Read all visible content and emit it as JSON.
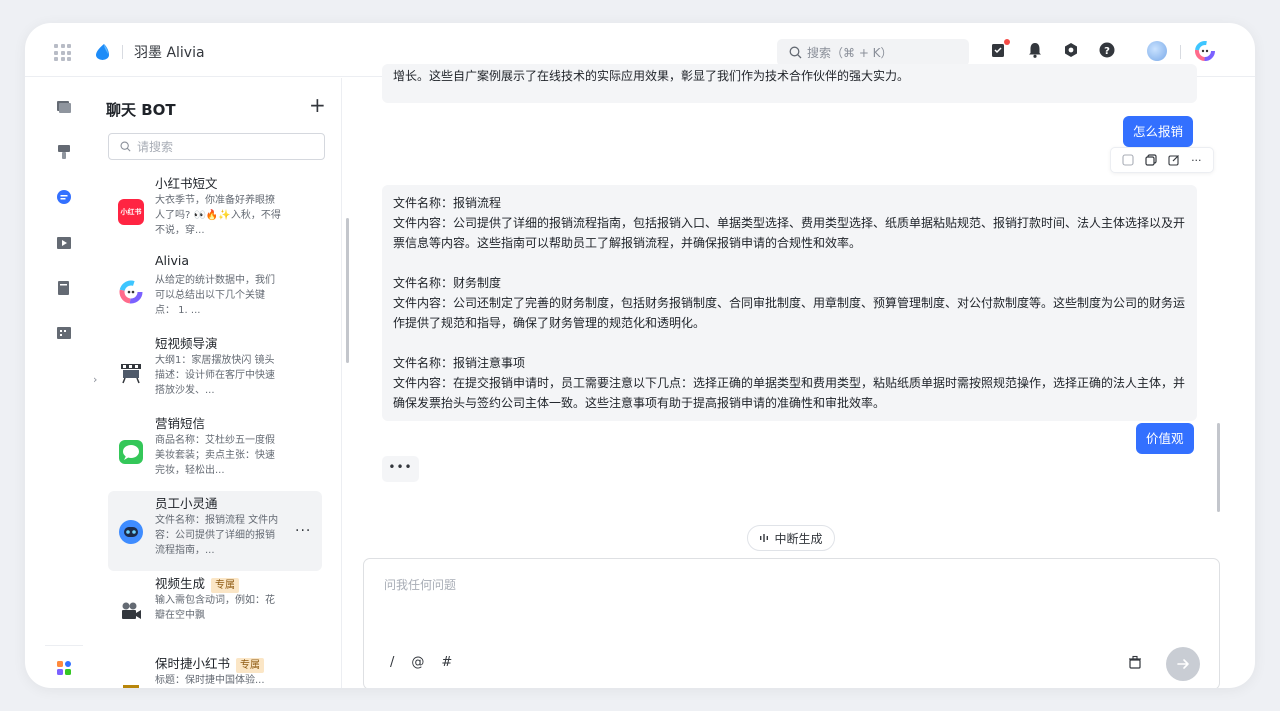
{
  "app": {
    "title": "羽墨 Alivia",
    "search_placeholder": "搜索（⌘ + K）"
  },
  "panel": {
    "title": "聊天 BOT",
    "add_label": "+",
    "search_placeholder": "请搜索",
    "bots": [
      {
        "name": "小红书短文",
        "desc": "大衣季节，你准备好养眼撩人了吗? 👀🔥✨入秋，不得不说，穿...",
        "icon": "xiaohongshu-icon",
        "icon_text": "小红书",
        "tag": ""
      },
      {
        "name": "Alivia",
        "desc": "从给定的统计数据中，我们可以总结出以下几个关键点：  1. ...",
        "icon": "alivia-logo-icon",
        "tag": ""
      },
      {
        "name": "短视频导演",
        "desc": "大纲1：家居摆放快闪 镜头描述：设计师在客厅中快速搭放沙发、...",
        "icon": "film-director-icon",
        "tag": ""
      },
      {
        "name": "营销短信",
        "desc": "商品名称：艾杜纱五一度假美妆套装；卖点主张：快速完妆，轻松出...",
        "icon": "message-icon",
        "tag": ""
      },
      {
        "name": "员工小灵通",
        "desc": "文件名称：报销流程 文件内容：公司提供了详细的报销流程指南，...",
        "icon": "robot-icon",
        "tag": "",
        "more": "..."
      },
      {
        "name": "视频生成",
        "desc": "输入需包含动词，例如：花瓣在空中飘",
        "icon": "video-camera-icon",
        "tag": "专属"
      },
      {
        "name": "保时捷小红书",
        "desc": "标题：保时捷中国体验...",
        "icon": "porsche-icon",
        "tag": "专属"
      }
    ]
  },
  "chat": {
    "prev_tail": "增长。这些自广案例展示了在线技术的实际应用效果，彰显了我们作为技术合作伙伴的强大实力。",
    "user_msg_1": "怎么报销",
    "answer": [
      {
        "name_line": "文件名称：报销流程",
        "content_line": "文件内容：公司提供了详细的报销流程指南，包括报销入口、单据类型选择、费用类型选择、纸质单据粘贴规范、报销打款时间、法人主体选择以及开票信息等内容。这些指南可以帮助员工了解报销流程，并确保报销申请的合规性和效率。"
      },
      {
        "name_line": "文件名称：财务制度",
        "content_line": "文件内容：公司还制定了完善的财务制度，包括财务报销制度、合同审批制度、用章制度、预算管理制度、对公付款制度等。这些制度为公司的财务运作提供了规范和指导，确保了财务管理的规范化和透明化。"
      },
      {
        "name_line": "文件名称：报销注意事项",
        "content_line": "文件内容：在提交报销申请时，员工需要注意以下几点：选择正确的单据类型和费用类型，粘贴纸质单据时需按照规范操作，选择正确的法人主体，并确保发票抬头与签约公司主体一致。这些注意事项有助于提高报销申请的准确性和审批效率。"
      }
    ],
    "user_msg_2": "价值观",
    "typing": "•••",
    "stop_label": "中断生成",
    "input_placeholder": "问我任何问题",
    "tool_slash": "/",
    "tool_at": "@",
    "tool_hash": "#"
  },
  "colors": {
    "accent": "#3370ff",
    "bubble_ai": "#f4f5f7",
    "send_disabled": "#c9cdd4"
  }
}
